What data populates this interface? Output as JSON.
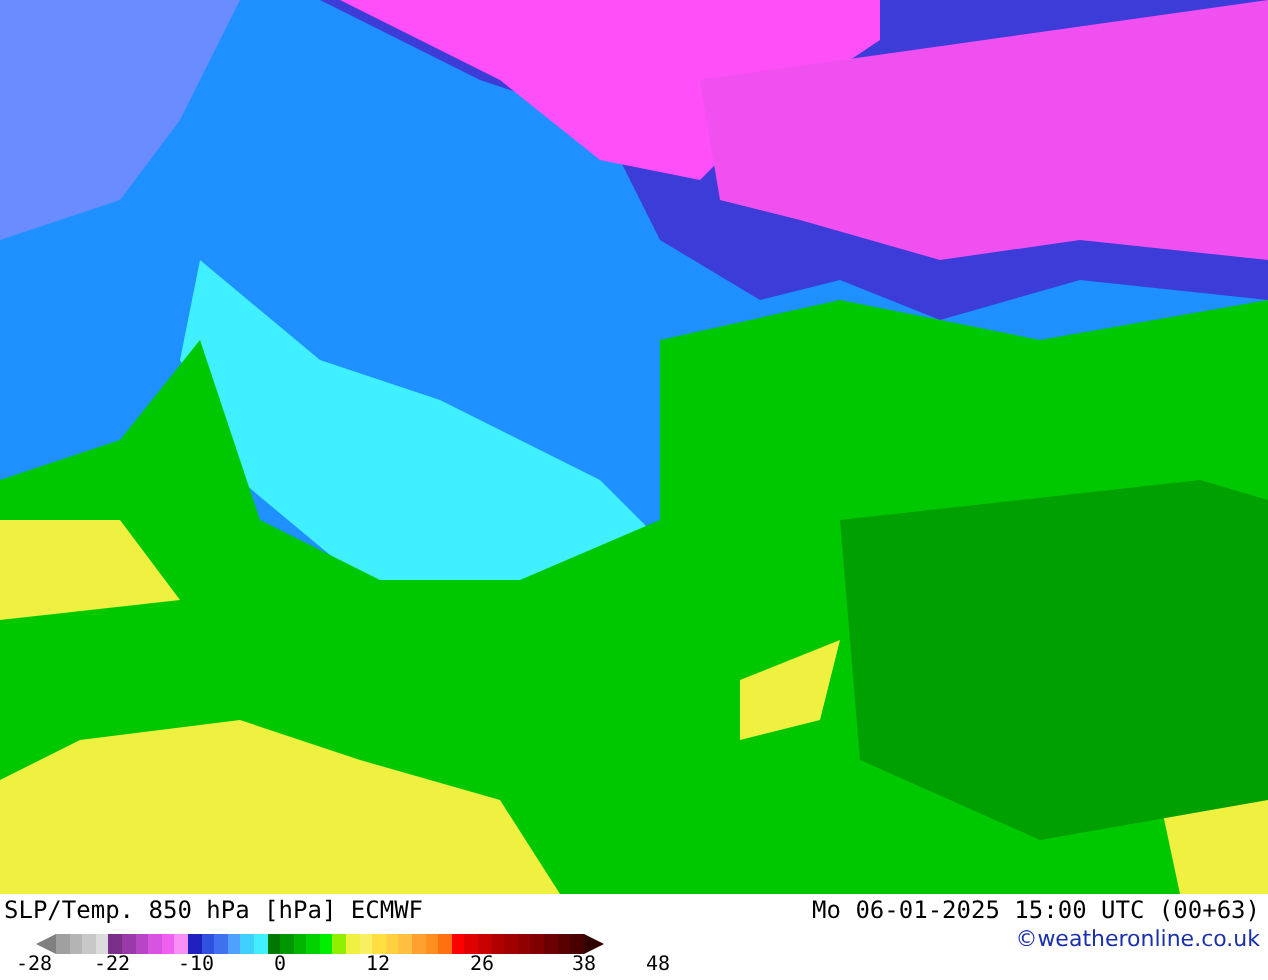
{
  "map": {
    "title": "SLP/Temp. 850 hPa [hPa] ECMWF",
    "valid_time": "Mo 06-01-2025 15:00 UTC (00+63)"
  },
  "legend": {
    "ticks": [
      "-28",
      "-22",
      "-10",
      "0",
      "12",
      "26",
      "38",
      "48"
    ]
  },
  "credit": "©weatheronline.co.uk"
}
